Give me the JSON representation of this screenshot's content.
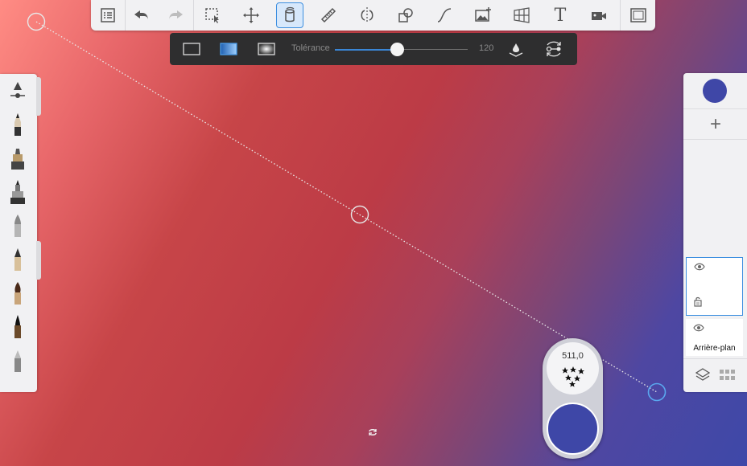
{
  "canvas": {
    "gradient_start": "#ff8c84",
    "gradient_mid": "#bc3b46",
    "gradient_end": "#3e48a8"
  },
  "toolbar": {
    "tools": [
      "list-icon",
      "undo-icon",
      "redo-icon",
      "selection-icon",
      "transform-icon",
      "fill-icon",
      "ruler-icon",
      "symmetry-icon",
      "shape-icon",
      "curve-icon",
      "image-icon",
      "perspective-icon",
      "text-icon",
      "video-icon",
      "fullscreen-icon"
    ],
    "active_tool": "fill-icon",
    "text_tool_glyph": "T"
  },
  "fillbar": {
    "modes": [
      "solid-fill-icon",
      "linear-gradient-icon",
      "radial-gradient-icon"
    ],
    "active_mode": "linear-gradient-icon",
    "tolerance_label": "Tolérance",
    "tolerance_value": "120",
    "tolerance_fraction": 0.47,
    "accent": "#3a86d6"
  },
  "brushes": [
    "size-slider-icon",
    "pencil-icon",
    "marker-icon",
    "airbrush-icon",
    "paint-brush-icon",
    "fountain-pen-icon",
    "round-brush-icon",
    "ink-brush-icon",
    "eraser-icon"
  ],
  "layers": {
    "current_color": "#3f47a7",
    "add_label": "+",
    "items": [
      {
        "name": "",
        "active": true
      },
      {
        "name": "Arrière-plan",
        "active": false
      }
    ]
  },
  "puck": {
    "value": "511,0",
    "color": "#3e47a7"
  }
}
